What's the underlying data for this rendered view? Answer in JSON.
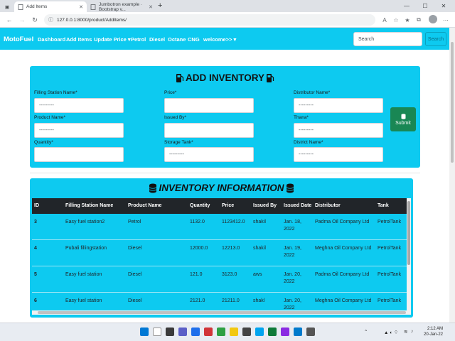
{
  "browser": {
    "tabs": [
      {
        "title": "Add Items",
        "active": true
      },
      {
        "title": "Jumbotron example · Bootstrap v...",
        "active": false
      }
    ],
    "url": "127.0.0.1:8000/product/AddItems/"
  },
  "navbar": {
    "brand": "MotoFuel",
    "links": [
      "Dashboard",
      "Add Items",
      "Update Price ▾",
      "Petrol",
      "Diesel",
      "Octane",
      "CNG",
      "welcome>> ▾"
    ],
    "search_placeholder": "Search",
    "search_button": "Search",
    "accent_color": "#0dcaf0"
  },
  "add_inventory": {
    "title": "ADD INVENTORY",
    "fields": [
      {
        "label": "Filling Station Name*",
        "value": "---------"
      },
      {
        "label": "Price*",
        "value": ""
      },
      {
        "label": "Distributor Name*",
        "value": "---------"
      },
      {
        "label": "Product Name*",
        "value": "---------"
      },
      {
        "label": "Issued By*",
        "value": ""
      },
      {
        "label": "Thana*",
        "value": "---------"
      },
      {
        "label": "Quantity*",
        "value": ""
      },
      {
        "label": "Storage Tank*",
        "value": "---------"
      },
      {
        "label": "District Name*",
        "value": "---------"
      }
    ],
    "submit_label": "Submit",
    "submit_color": "#198754"
  },
  "inventory_info": {
    "title": "INVENTORY INFORMATION",
    "columns": [
      "ID",
      "Filling Station Name",
      "Product Name",
      "Quantity",
      "Price",
      "Issued By",
      "Issued Date",
      "Distributor",
      "Tank"
    ],
    "rows": [
      [
        "3",
        "Easy fuel station2",
        "Petrol",
        "1132.0",
        "1123412.0",
        "shakil",
        "Jan. 18, 2022",
        "Padma Oil Company Ltd",
        "PetrolTank"
      ],
      [
        "4",
        "Pubali fillingstation",
        "Diesel",
        "12000.0",
        "12213.0",
        "shakil",
        "Jan. 19, 2022",
        "Meghna Oil Company Ltd",
        "PetrolTank"
      ],
      [
        "5",
        "Easy fuel station",
        "Diesel",
        "121.0",
        "3123.0",
        "aws",
        "Jan. 20, 2022",
        "Padma Oil Company Ltd",
        "PetrolTank"
      ],
      [
        "6",
        "Easy fuel station",
        "Diesel",
        "2121.0",
        "21211.0",
        "shakl",
        "Jan. 20, 2022",
        "Meghna Oil Company Ltd",
        "PetrolTank"
      ]
    ]
  },
  "taskbar": {
    "time": "2:12 AM",
    "date": "20-Jan-22"
  }
}
